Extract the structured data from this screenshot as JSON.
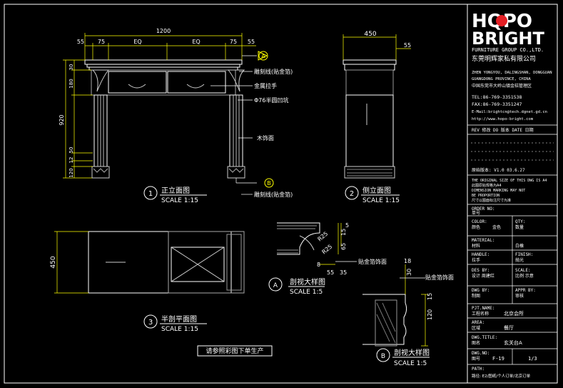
{
  "brand": {
    "logo_top": "HQPO",
    "logo_bottom": "BRIGHT",
    "company_en": "FURNITURE GROUP CO.,LTD.",
    "company_cn": "东莞明辉家私有限公司",
    "addr1": "ZHEN YONGYOU, DALINGSHAN, DONGGUAN",
    "addr2": "GUANGDONG PROVINCE, CHINA",
    "addr3": "中国东莞市大岭山镇金桔管理区",
    "tel": "TEL:86-769-3351538",
    "fax": "FAX:86-769-3351247",
    "email": "E-Mail:brightcn@tech.dgnet.gd.cn",
    "web": "http://www.hopo-bright.com"
  },
  "title_block": {
    "rev_header": "REV 修改   DO 版本   DATE 日期",
    "revision": "原始版本:   V1.0   03.6.27",
    "note1": "THE ORIGINAL SIZE OF THIS DWG IS A4",
    "note2": "此图原始规格为A4",
    "note3": "DIMENSION MARKING MAY NOT",
    "note4": "BE PROPORTION",
    "note5": "尺寸以图面标注尺寸为准",
    "order_no": "ORDER NO:",
    "order_cn": "单号",
    "color_label": "COLOR:",
    "color_cn": "颜色",
    "color_val": "金色",
    "qty_label": "QTY:",
    "qty_val": "数量",
    "material_label": "MATERIAL:",
    "material_cn": "材料",
    "material_val": "白橡",
    "handle_label": "HANDLE:",
    "handle_cn": "拉手",
    "handle_val": "铜质",
    "finish_label": "FINISH:",
    "finish_val": "抛光",
    "des_label": "DES BY:",
    "des_cn": "设计 周建红",
    "scale_label": "SCALE:",
    "scale_val": "比例 示意",
    "dwg_label": "DWG BY:",
    "dwg_cn": "制图",
    "appr_label": "APPR BY:",
    "appr_cn": "审核",
    "pjt_label": "PJT.NAME:",
    "pjt_cn": "工程名称",
    "pjt_val": "北京会所",
    "area_label": "AREA:",
    "area_cn": "区域",
    "area_val": "餐厅",
    "dwg_title_label": "DWG.TITLE:",
    "dwg_title_cn": "图名",
    "dwg_title_val": "玄关台A",
    "dwg_no_label": "DWG.NO:",
    "dwg_no_cn": "图号",
    "dwg_no_val": "F-19",
    "sheet": "1/3",
    "path_label": "PATH:",
    "path_val": "路径: E2/图纸/个人订单/北京订单"
  },
  "front_view": {
    "number": "1",
    "title": "正立面图",
    "scale": "SCALE 1:15",
    "dims_top": [
      "55",
      "75",
      "EQ",
      "EQ",
      "75",
      "55"
    ],
    "overall_width": "1200",
    "dims_left": [
      "30",
      "180",
      "920",
      "50",
      "12",
      "120"
    ],
    "callout_a": "A",
    "callout_b": "B",
    "label_carving": "雕刻线(贴金箔)",
    "label_handle": "金属拉手",
    "label_profile": "Φ76半圆凹坑",
    "label_wood": "木饰面",
    "label_carving_bottom": "雕刻线(贴金箔)"
  },
  "side_view": {
    "number": "2",
    "title": "侧立面图",
    "scale": "SCALE 1:15",
    "width": "450",
    "dim_right": "55"
  },
  "plan_view": {
    "number": "3",
    "title": "半剖平面图",
    "scale": "SCALE 1:15",
    "depth": "450"
  },
  "detail_a": {
    "letter": "A",
    "title": "剖视大样图",
    "scale": "SCALE 1:5",
    "r1": "R25",
    "r2": "R25",
    "dims": [
      "5",
      "15",
      "65",
      "8",
      "55",
      "35"
    ],
    "label": "贴金箔饰面"
  },
  "detail_b": {
    "letter": "B",
    "title": "剖视大样图",
    "scale": "SCALE 1:5",
    "dims": [
      "18",
      "30",
      "15",
      "120"
    ],
    "label": "贴金箔饰面"
  },
  "note_box": "请参照彩图下单生产",
  "colors": {
    "background": "#000000",
    "line": "#ffffff",
    "dimension": "#ffff00",
    "hatch": "#c0c0c0",
    "logo_red": "#e31e24",
    "text": "#ffffff"
  }
}
